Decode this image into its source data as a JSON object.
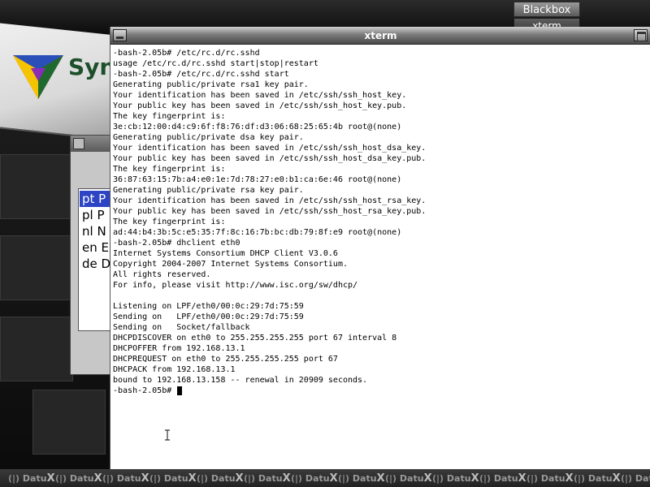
{
  "toolbar": {
    "workspace_label": "Blackbox",
    "window_label": "xterm"
  },
  "background": {
    "logo_text": "Syn"
  },
  "dialog": {
    "items": [
      {
        "label": "pt  P",
        "selected": true
      },
      {
        "label": "pl  P",
        "selected": false
      },
      {
        "label": "nl  N",
        "selected": false
      },
      {
        "label": "en  E",
        "selected": false
      },
      {
        "label": "de  D",
        "selected": false
      }
    ]
  },
  "xterm": {
    "title": "xterm",
    "lines": [
      "-bash-2.05b# /etc/rc.d/rc.sshd",
      "usage /etc/rc.d/rc.sshd start|stop|restart",
      "-bash-2.05b# /etc/rc.d/rc.sshd start",
      "Generating public/private rsa1 key pair.",
      "Your identification has been saved in /etc/ssh/ssh_host_key.",
      "Your public key has been saved in /etc/ssh/ssh_host_key.pub.",
      "The key fingerprint is:",
      "3e:cb:12:00:d4:c9:6f:f8:76:df:d3:06:68:25:65:4b root@(none)",
      "Generating public/private dsa key pair.",
      "Your identification has been saved in /etc/ssh/ssh_host_dsa_key.",
      "Your public key has been saved in /etc/ssh/ssh_host_dsa_key.pub.",
      "The key fingerprint is:",
      "36:87:63:15:7b:a4:e0:1e:7d:78:27:e0:b1:ca:6e:46 root@(none)",
      "Generating public/private rsa key pair.",
      "Your identification has been saved in /etc/ssh/ssh_host_rsa_key.",
      "Your public key has been saved in /etc/ssh/ssh_host_rsa_key.pub.",
      "The key fingerprint is:",
      "ad:44:b4:3b:5c:e5:35:7f:8c:16:7b:bc:db:79:8f:e9 root@(none)",
      "-bash-2.05b# dhclient eth0",
      "Internet Systems Consortium DHCP Client V3.0.6",
      "Copyright 2004-2007 Internet Systems Consortium.",
      "All rights reserved.",
      "For info, please visit http://www.isc.org/sw/dhcp/",
      "",
      "Listening on LPF/eth0/00:0c:29:7d:75:59",
      "Sending on   LPF/eth0/00:0c:29:7d:75:59",
      "Sending on   Socket/fallback",
      "DHCPDISCOVER on eth0 to 255.255.255.255 port 67 interval 8",
      "DHCPOFFER from 192.168.13.1",
      "DHCPREQUEST on eth0 to 255.255.255.255 port 67",
      "DHCPACK from 192.168.13.1",
      "bound to 192.168.13.158 -- renewal in 20909 seconds.",
      "-bash-2.05b# "
    ]
  },
  "dock": {
    "brand": "Datu",
    "brand_mark": "X",
    "symbol": "(|)"
  },
  "colors": {
    "selection": "#2d44c4",
    "terminal_bg": "#ffffff",
    "terminal_fg": "#000000"
  }
}
